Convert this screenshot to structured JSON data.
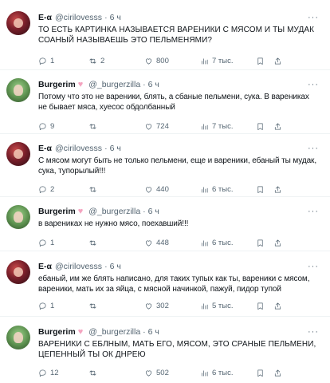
{
  "tweets": [
    {
      "name": "E-α",
      "handle": "@cirilovesss",
      "time": "6 ч",
      "text": "ТО ЕСТЬ КАРТИНКА НАЗЫВАЕТСЯ ВАРЕНИКИ С МЯСОМ И ТЫ МУДАК СОАНЫЙ НАЗЫВАЕШЬ ЭТО ПЕЛЬМЕНЯМИ?",
      "replies": "1",
      "retweets": "2",
      "likes": "800",
      "views": "7 тыс."
    },
    {
      "name": "Burgerim",
      "handle": "@_burgerzilla",
      "time": "6 ч",
      "text": "Потому что это не вареники, блять, а сбаные пельмени, сука. В варениках не бывает мяса, хуесос обдолбанный",
      "replies": "9",
      "retweets": "",
      "likes": "724",
      "views": "7 тыс."
    },
    {
      "name": "E-α",
      "handle": "@cirilovesss",
      "time": "6 ч",
      "text": "С мясом могут быть не только пельмени, еще и вареники, ебаный ты мудак, сука, тупорылый!!!",
      "replies": "2",
      "retweets": "",
      "likes": "440",
      "views": "6 тыс."
    },
    {
      "name": "Burgerim",
      "handle": "@_burgerzilla",
      "time": "6 ч",
      "text": "в варениках не нужно мясо, поехавший!!!",
      "replies": "1",
      "retweets": "",
      "likes": "448",
      "views": "6 тыс."
    },
    {
      "name": "E-α",
      "handle": "@cirilovesss",
      "time": "6 ч",
      "text": "ебаный, им же блять написано, для таких тупых как ты, вареники с мясом, вареники, мать их за яйца, с мясной начинкой, пажуй, пидор тупой",
      "replies": "1",
      "retweets": "",
      "likes": "302",
      "views": "5 тыс."
    },
    {
      "name": "Burgerim",
      "handle": "@_burgerzilla",
      "time": "6 ч",
      "text": "ВАРЕНИКИ С ЕБЛНЫМ, МАТЬ ЕГО, МЯСОМ, ЭТО СРАНЫЕ ПЕЛЬМЕНИ, ЦЕПЕННЫЙ ТЫ ОК ДНРЕЮ",
      "replies": "12",
      "retweets": "",
      "likes": "502",
      "views": "6 тыс."
    }
  ]
}
